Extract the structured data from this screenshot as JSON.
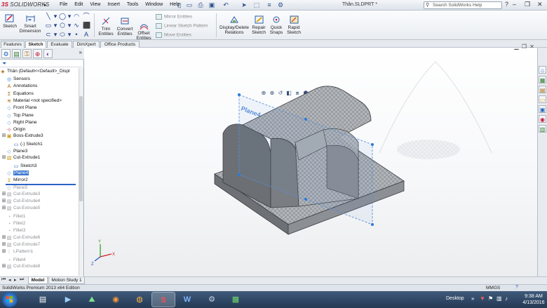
{
  "app": {
    "logo_ds": "3S",
    "logo_brand": "SOLIDWORKS",
    "doc_title": "Thân.SLDPRT *",
    "search_placeholder": "Search SolidWorks Help",
    "menu": [
      "File",
      "Edit",
      "View",
      "Insert",
      "Tools",
      "Window",
      "Help"
    ]
  },
  "commands": {
    "sketch": "Sketch",
    "smart_dimension": [
      "Smart",
      "Dimension"
    ],
    "trim": [
      "Trim",
      "Entities"
    ],
    "convert": [
      "Convert",
      "Entities"
    ],
    "offset": [
      "Offset",
      "Entities"
    ],
    "mirror": "Mirror Entities",
    "linear_pattern": "Linear Sketch Pattern",
    "move": "Move Entities",
    "display_delete": [
      "Display/Delete",
      "Relations"
    ],
    "repair": [
      "Repair",
      "Sketch"
    ],
    "quick_snaps": [
      "Quick",
      "Snaps"
    ],
    "rapid_sketch": [
      "Rapid",
      "Sketch"
    ]
  },
  "cm_tabs": [
    "Features",
    "Sketch",
    "Evaluate",
    "DimXpert",
    "Office Products"
  ],
  "cm_active_tab": "Sketch",
  "tree": {
    "root": "Thân  (Default<<Default>_Displ",
    "items": [
      {
        "label": "Sensors",
        "icon": "sensor-icon"
      },
      {
        "label": "Annotations",
        "icon": "annotation-icon"
      },
      {
        "label": "Equations",
        "icon": "equation-icon"
      },
      {
        "label": "Material <not specified>",
        "icon": "material-icon"
      },
      {
        "label": "Front Plane",
        "icon": "plane-icon"
      },
      {
        "label": "Top Plane",
        "icon": "plane-icon"
      },
      {
        "label": "Right Plane",
        "icon": "plane-icon"
      },
      {
        "label": "Origin",
        "icon": "origin-icon"
      },
      {
        "label": "Boss-Extrude3",
        "icon": "boss-extrude-icon"
      },
      {
        "label": "(-) Sketch1",
        "icon": "sketch-icon"
      },
      {
        "label": "Plane3",
        "icon": "plane-icon"
      },
      {
        "label": "Cut-Extrude1",
        "icon": "cut-extrude-icon"
      },
      {
        "label": "Sketch3",
        "icon": "sketch-icon"
      },
      {
        "label": "Plane4",
        "icon": "plane-icon"
      },
      {
        "label": "Mirror2",
        "icon": "mirror-icon"
      },
      {
        "label": "Plane5",
        "icon": "plane-icon"
      },
      {
        "label": "Cut-Extrude3",
        "icon": "cut-extrude-icon"
      },
      {
        "label": "Cut-Extrude4",
        "icon": "cut-extrude-icon"
      },
      {
        "label": "Cut-Extrude5",
        "icon": "cut-extrude-icon"
      },
      {
        "label": "Fillet1",
        "icon": "fillet-icon"
      },
      {
        "label": "Fillet2",
        "icon": "fillet-icon"
      },
      {
        "label": "Fillet3",
        "icon": "fillet-icon"
      },
      {
        "label": "Cut-Extrude6",
        "icon": "cut-extrude-icon"
      },
      {
        "label": "Cut-Extrude7",
        "icon": "cut-extrude-icon"
      },
      {
        "label": "LPattern1",
        "icon": "pattern-icon"
      },
      {
        "label": "Fillet4",
        "icon": "fillet-icon"
      },
      {
        "label": "Cut-Extrude8",
        "icon": "cut-extrude-icon"
      }
    ]
  },
  "viewport": {
    "plane_label": "Plane4",
    "triad": {
      "x": "X",
      "y": "Y",
      "z": "Z"
    }
  },
  "bottom_tabs": [
    "Model",
    "Motion Study 1"
  ],
  "status": {
    "text": "SolidWorks Premium 2013 x64 Edition",
    "units": "MMGS"
  },
  "taskbar": {
    "desktop_label": "Desktop",
    "time": "9:38 AM",
    "date": "4/13/2016"
  },
  "colors": {
    "brand_red": "#c8102e",
    "selection": "#3b79d0",
    "plane_blue": "#5a8fd8",
    "model_grey": "#8e9296"
  }
}
